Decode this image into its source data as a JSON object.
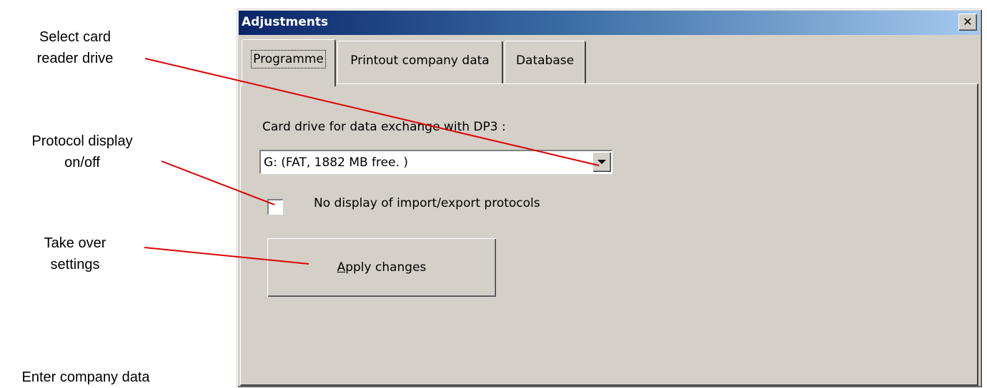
{
  "annotations": [
    "Select card\nreader drive",
    "Protocol display\non/off",
    "Take over\nsettings",
    "Enter company data"
  ],
  "dialog": {
    "title": "Adjustments",
    "close_label": "✕",
    "tabs": [
      {
        "label": "Programme",
        "selected": true
      },
      {
        "label": "Printout company data",
        "selected": false
      },
      {
        "label": "Database",
        "selected": false
      }
    ],
    "card_drive_label": "Card drive for data exchange with DP3 :",
    "card_drive_value": "G:  (FAT, 1882 MB free. )",
    "no_protocol_label": "No display of import/export protocols",
    "no_protocol_checked": false,
    "apply_button": {
      "mnemonic": "A",
      "rest": "pply changes"
    }
  },
  "colors": {
    "arrow": "#e00000",
    "window_face": "#d4d0c8",
    "title_start": "#0a246a",
    "title_end": "#a6caf0"
  }
}
